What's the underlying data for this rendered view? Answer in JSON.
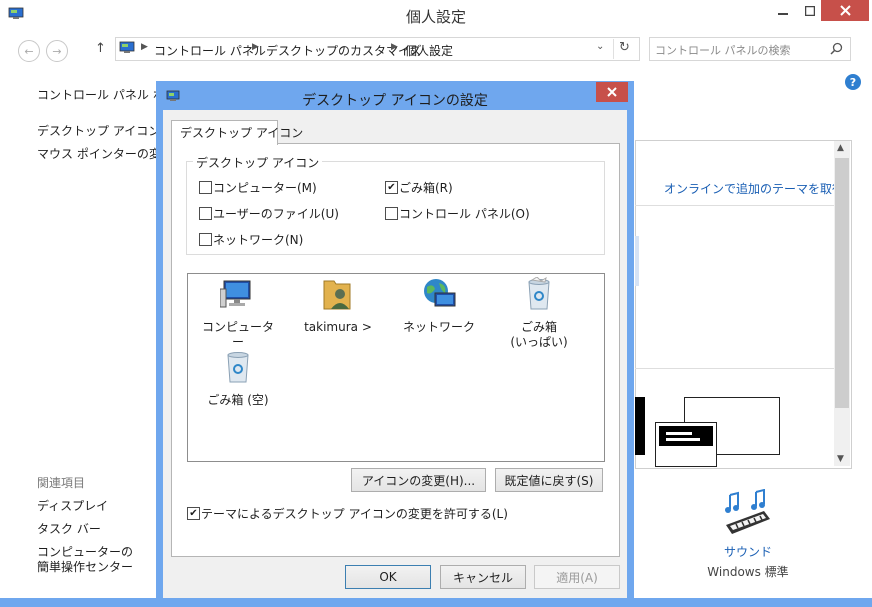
{
  "window": {
    "title": "個人設定"
  },
  "address": {
    "crumbs": [
      "コントロール パネル",
      "デスクトップのカスタマイズ",
      "個人設定"
    ],
    "search_placeholder": "コントロール パネルの検索"
  },
  "left_nav": {
    "home": "コントロール パネル ホーム",
    "links": [
      "デスクトップ アイコンの変更",
      "マウス ポインターの変更"
    ],
    "related_heading": "関連項目",
    "related": [
      "ディスプレイ",
      "タスク バー",
      "コンピューターの",
      "簡単操作センター"
    ]
  },
  "right_pane": {
    "online_themes": "オンラインで追加のテーマを取得",
    "sound_label": "サウンド",
    "sound_value": "Windows 標準"
  },
  "dialog": {
    "title": "デスクトップ アイコンの設定",
    "tab": "デスクトップ アイコン",
    "group_label": "デスクトップ アイコン",
    "checkboxes": [
      {
        "label": "コンピューター(M)",
        "checked": false
      },
      {
        "label": "ごみ箱(R)",
        "checked": true
      },
      {
        "label": "ユーザーのファイル(U)",
        "checked": false
      },
      {
        "label": "コントロール パネル(O)",
        "checked": false
      },
      {
        "label": "ネットワーク(N)",
        "checked": false
      }
    ],
    "icons": [
      {
        "label": "コンピューター",
        "icon": "computer-icon"
      },
      {
        "label": "takimura >",
        "icon": "user-folder-icon"
      },
      {
        "label": "ネットワーク",
        "icon": "network-icon"
      },
      {
        "label": "ごみ箱",
        "label2": "(いっぱい)",
        "icon": "recycle-bin-full-icon"
      },
      {
        "label": "ごみ箱 (空)",
        "icon": "recycle-bin-empty-icon"
      }
    ],
    "change_icon_button": "アイコンの変更(H)...",
    "restore_default_button": "既定値に戻す(S)",
    "allow_themes_label": "テーマによるデスクトップ アイコンの変更を許可する(L)",
    "allow_themes_checked": true,
    "ok_button": "OK",
    "cancel_button": "キャンセル",
    "apply_button": "適用(A)"
  },
  "colors": {
    "accent": "#6fa7ee",
    "close": "#c7504a",
    "link": "#1a5fb4"
  }
}
